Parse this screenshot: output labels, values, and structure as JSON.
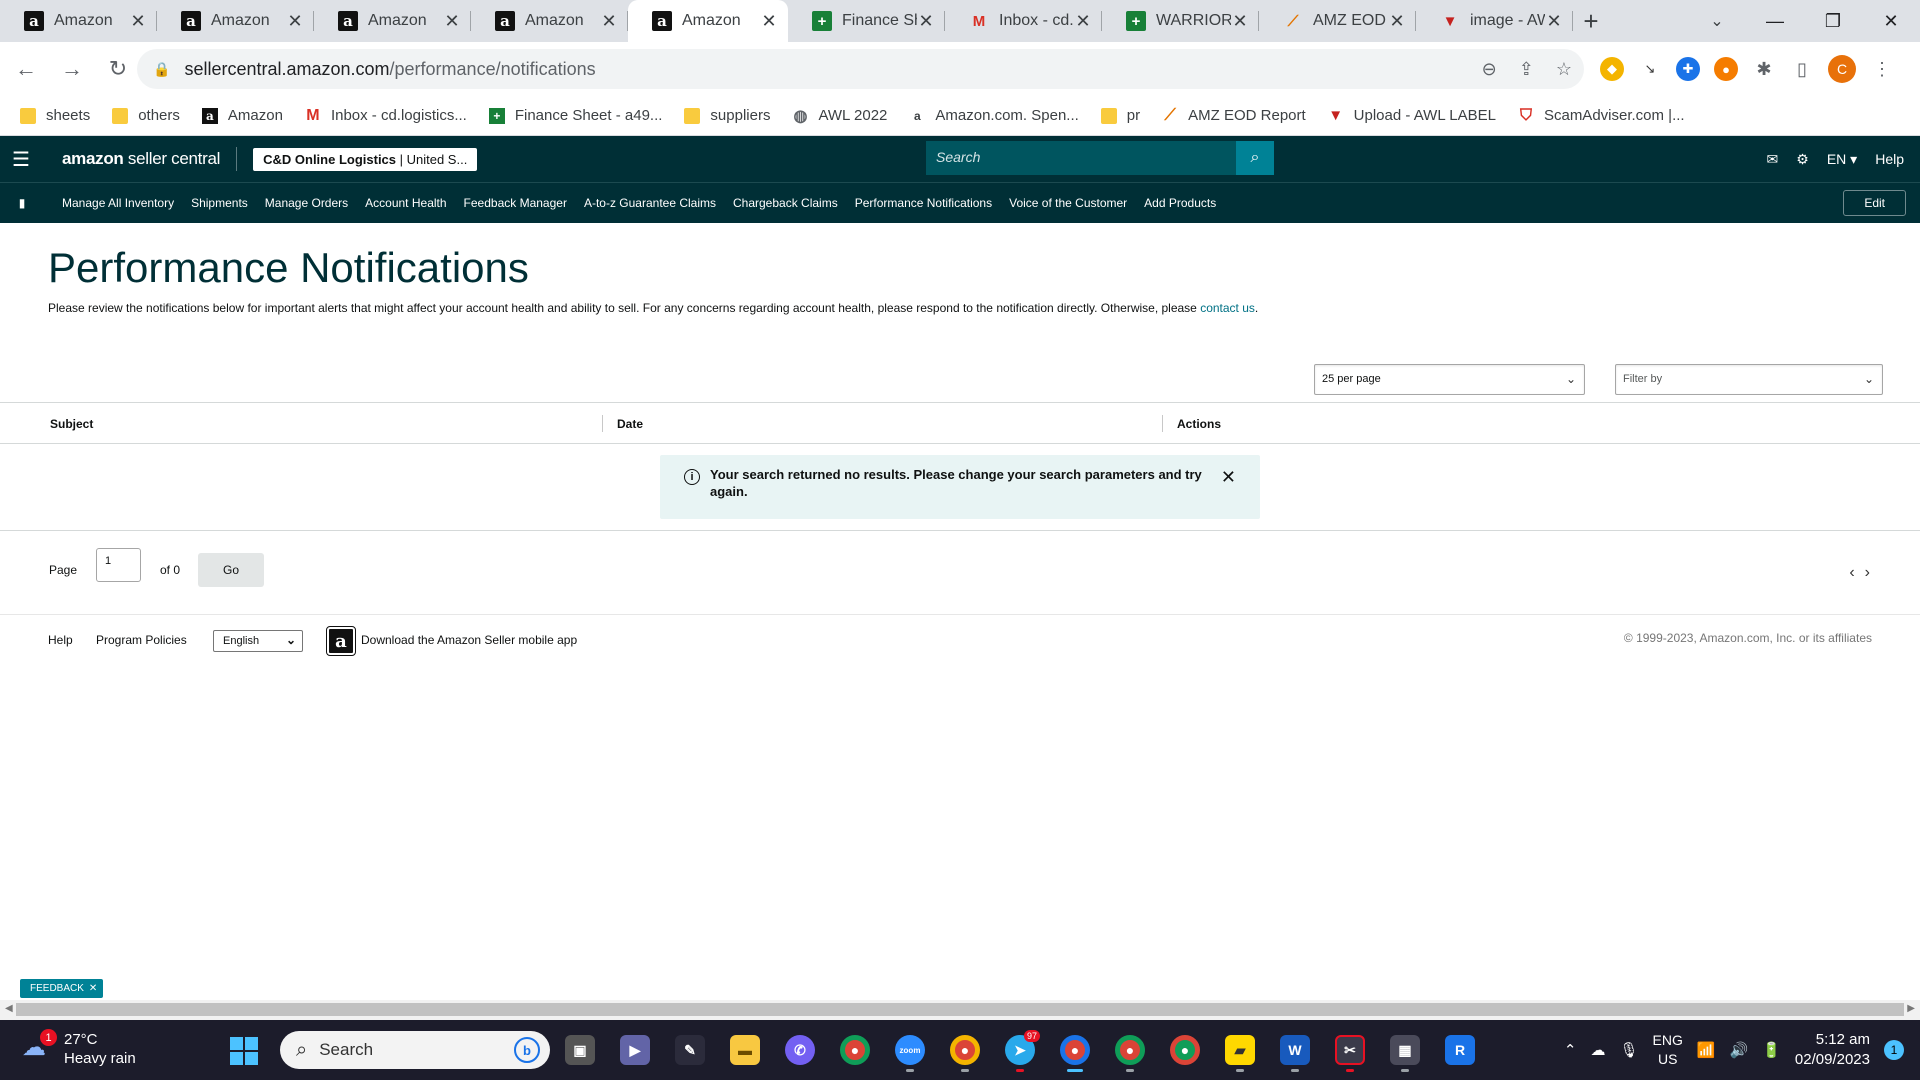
{
  "browser": {
    "tabs": [
      {
        "title": "Amazon",
        "icon": "amazon-icon",
        "active": false
      },
      {
        "title": "Amazon",
        "icon": "amazon-icon",
        "active": false
      },
      {
        "title": "Amazon",
        "icon": "amazon-icon",
        "active": false
      },
      {
        "title": "Amazon",
        "icon": "amazon-icon",
        "active": false
      },
      {
        "title": "Amazon",
        "icon": "amazon-icon",
        "active": true
      },
      {
        "title": "Finance She",
        "icon": "sheets-icon",
        "active": false
      },
      {
        "title": "Inbox - cd.l",
        "icon": "gmail-icon",
        "active": false
      },
      {
        "title": "WARRIORS",
        "icon": "sheets-icon",
        "active": false
      },
      {
        "title": "AMZ EOD R",
        "icon": "amz-eod-icon",
        "active": false
      },
      {
        "title": "image - AW",
        "icon": "awl-icon",
        "active": false
      }
    ],
    "url_host": "sellercentral.amazon.com",
    "url_path": "/performance/notifications",
    "profile_initial": "C",
    "bookmarks": [
      {
        "label": "sheets",
        "icon": "folder-icon"
      },
      {
        "label": "others",
        "icon": "folder-icon"
      },
      {
        "label": "Amazon",
        "icon": "amazon-icon"
      },
      {
        "label": "Inbox - cd.logistics...",
        "icon": "gmail-icon"
      },
      {
        "label": "Finance Sheet - a49...",
        "icon": "sheets-icon"
      },
      {
        "label": "suppliers",
        "icon": "folder-icon"
      },
      {
        "label": "AWL 2022",
        "icon": "globe-icon"
      },
      {
        "label": "Amazon.com. Spen...",
        "icon": "amazon-a-icon"
      },
      {
        "label": "pr",
        "icon": "folder-icon"
      },
      {
        "label": "AMZ EOD Report",
        "icon": "amz-eod-icon"
      },
      {
        "label": "Upload - AWL LABEL",
        "icon": "awl-icon"
      },
      {
        "label": "ScamAdviser.com |...",
        "icon": "shield-icon"
      }
    ]
  },
  "header": {
    "logo_bold": "amazon",
    "logo_light": " seller central",
    "account_name": "C&D Online Logistics",
    "account_region": " | United S...",
    "search_placeholder": "Search",
    "language": "EN",
    "help": "Help"
  },
  "nav": {
    "items": [
      "Manage All Inventory",
      "Shipments",
      "Manage Orders",
      "Account Health",
      "Feedback Manager",
      "A-to-z Guarantee Claims",
      "Chargeback Claims",
      "Performance Notifications",
      "Voice of the Customer",
      "Add Products"
    ],
    "edit_label": "Edit"
  },
  "page": {
    "title": "Performance Notifications",
    "description": "Please review the notifications below for important alerts that might affect your account health and ability to sell. For any concerns regarding account health, please respond to the notification directly. Otherwise, please ",
    "contact_link": "contact us",
    "description_end": ".",
    "per_page": "25 per page",
    "filter_placeholder": "Filter by",
    "columns": [
      "Subject",
      "Date",
      "Actions"
    ],
    "alert_message": "Your search returned no results. Please change your search parameters and try again.",
    "pager": {
      "page_label": "Page",
      "current_page": "1",
      "of_label": "of 0",
      "go_label": "Go"
    }
  },
  "footer": {
    "help": "Help",
    "program_policies": "Program Policies",
    "language": "English",
    "app_download": "Download the Amazon Seller mobile app",
    "copyright": "© 1999-2023, Amazon.com, Inc. or its affiliates"
  },
  "feedback_label": "FEEDBACK",
  "taskbar": {
    "weather_temp": "27°C",
    "weather_desc": "Heavy rain",
    "weather_badge": "1",
    "search_label": "Search",
    "telegram_count": "97",
    "lang_top": "ENG",
    "lang_bottom": "US",
    "time": "5:12 am",
    "date": "02/09/2023",
    "notification_count": "1"
  }
}
